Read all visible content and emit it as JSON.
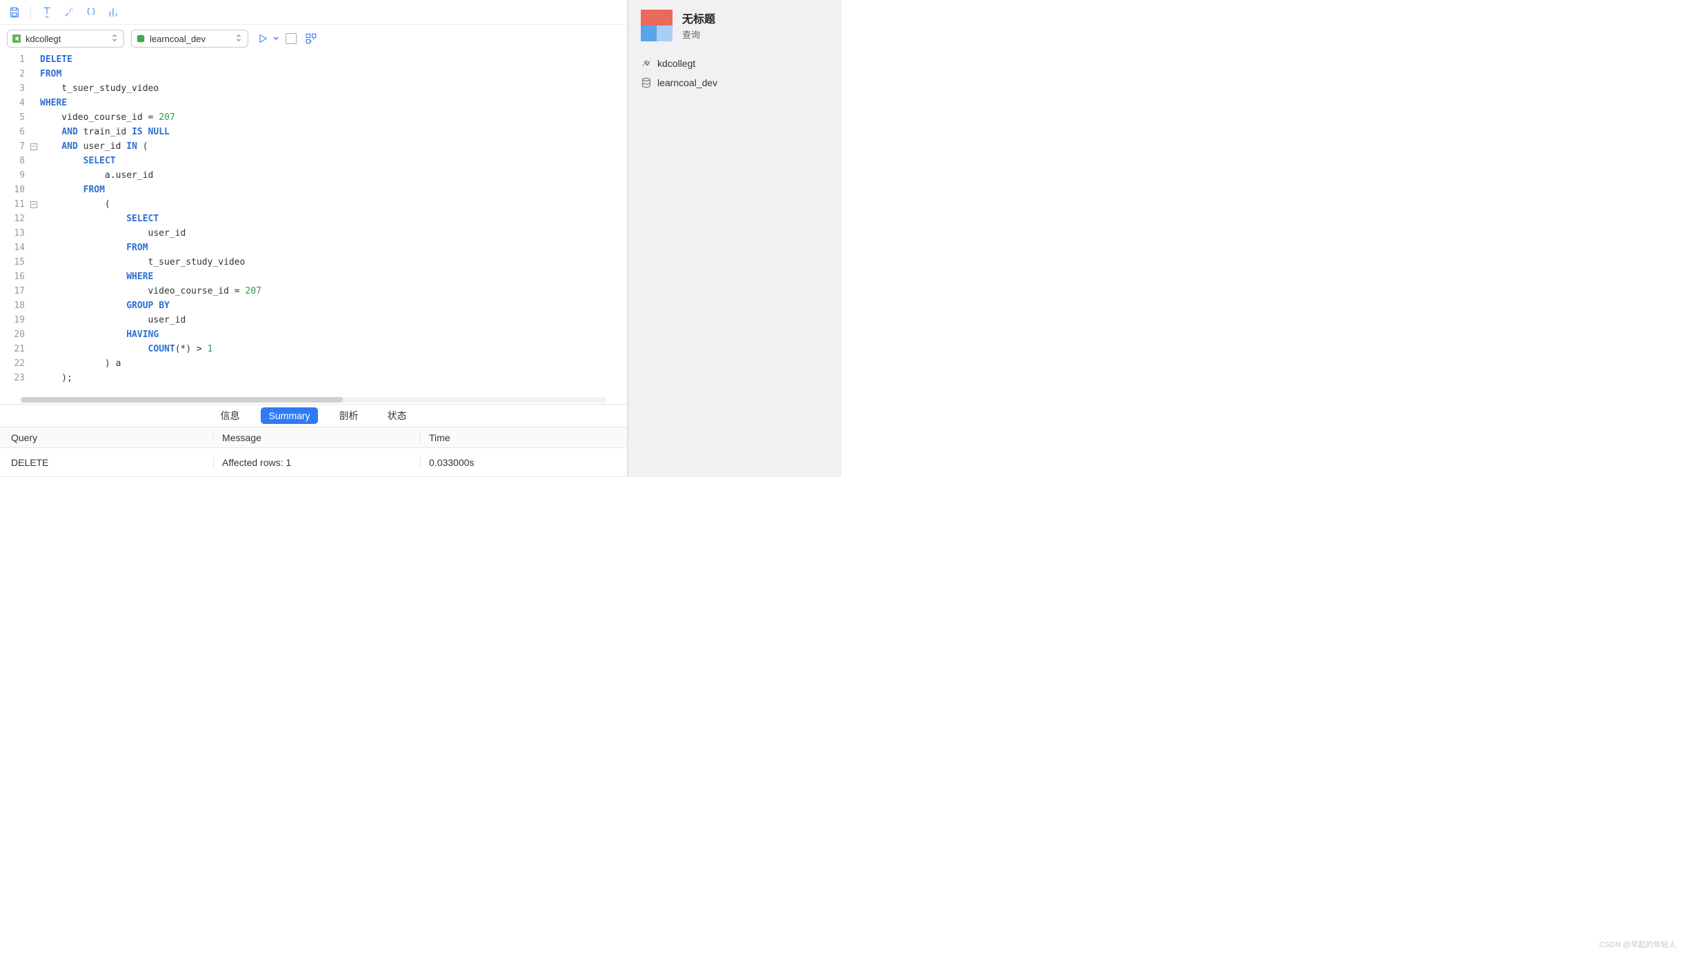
{
  "toolbar": {
    "connection_selector": "kdcollegt",
    "database_selector": "learncoal_dev"
  },
  "editor": {
    "lines": [
      {
        "n": 1,
        "fold": "",
        "tokens": [
          [
            "kw",
            "DELETE"
          ]
        ]
      },
      {
        "n": 2,
        "fold": "",
        "tokens": [
          [
            "kw",
            "FROM"
          ]
        ]
      },
      {
        "n": 3,
        "fold": "",
        "tokens": [
          [
            "ident",
            "    t_suer_study_video"
          ]
        ]
      },
      {
        "n": 4,
        "fold": "",
        "tokens": [
          [
            "kw",
            "WHERE"
          ]
        ]
      },
      {
        "n": 5,
        "fold": "",
        "tokens": [
          [
            "ident",
            "    video_course_id = "
          ],
          [
            "num",
            "207"
          ]
        ]
      },
      {
        "n": 6,
        "fold": "",
        "tokens": [
          [
            "ident",
            "    "
          ],
          [
            "kw",
            "AND"
          ],
          [
            "ident",
            " train_id "
          ],
          [
            "kw",
            "IS NULL"
          ]
        ]
      },
      {
        "n": 7,
        "fold": "-",
        "tokens": [
          [
            "ident",
            "    "
          ],
          [
            "kw",
            "AND"
          ],
          [
            "ident",
            " user_id "
          ],
          [
            "kw",
            "IN"
          ],
          [
            "ident",
            " ("
          ]
        ]
      },
      {
        "n": 8,
        "fold": "",
        "tokens": [
          [
            "ident",
            "        "
          ],
          [
            "kw",
            "SELECT"
          ]
        ]
      },
      {
        "n": 9,
        "fold": "",
        "tokens": [
          [
            "ident",
            "            a.user_id"
          ]
        ]
      },
      {
        "n": 10,
        "fold": "",
        "tokens": [
          [
            "ident",
            "        "
          ],
          [
            "kw",
            "FROM"
          ]
        ]
      },
      {
        "n": 11,
        "fold": "-",
        "tokens": [
          [
            "ident",
            "            ("
          ]
        ]
      },
      {
        "n": 12,
        "fold": "",
        "tokens": [
          [
            "ident",
            "                "
          ],
          [
            "kw",
            "SELECT"
          ]
        ]
      },
      {
        "n": 13,
        "fold": "",
        "tokens": [
          [
            "ident",
            "                    user_id"
          ]
        ]
      },
      {
        "n": 14,
        "fold": "",
        "tokens": [
          [
            "ident",
            "                "
          ],
          [
            "kw",
            "FROM"
          ]
        ]
      },
      {
        "n": 15,
        "fold": "",
        "tokens": [
          [
            "ident",
            "                    t_suer_study_video"
          ]
        ]
      },
      {
        "n": 16,
        "fold": "",
        "tokens": [
          [
            "ident",
            "                "
          ],
          [
            "kw",
            "WHERE"
          ]
        ]
      },
      {
        "n": 17,
        "fold": "",
        "tokens": [
          [
            "ident",
            "                    video_course_id = "
          ],
          [
            "num",
            "207"
          ]
        ]
      },
      {
        "n": 18,
        "fold": "",
        "tokens": [
          [
            "ident",
            "                "
          ],
          [
            "kw",
            "GROUP BY"
          ]
        ]
      },
      {
        "n": 19,
        "fold": "",
        "tokens": [
          [
            "ident",
            "                    user_id"
          ]
        ]
      },
      {
        "n": 20,
        "fold": "",
        "tokens": [
          [
            "ident",
            "                "
          ],
          [
            "kw",
            "HAVING"
          ]
        ]
      },
      {
        "n": 21,
        "fold": "",
        "tokens": [
          [
            "ident",
            "                    "
          ],
          [
            "kw2",
            "COUNT"
          ],
          [
            "ident",
            "(*) > "
          ],
          [
            "num",
            "1"
          ]
        ]
      },
      {
        "n": 22,
        "fold": "",
        "tokens": [
          [
            "ident",
            "            ) a"
          ]
        ]
      },
      {
        "n": 23,
        "fold": "",
        "tokens": [
          [
            "ident",
            "    );"
          ]
        ]
      }
    ]
  },
  "results": {
    "tabs": {
      "info": "信息",
      "summary": "Summary",
      "profile": "剖析",
      "status": "状态"
    },
    "headers": {
      "query": "Query",
      "message": "Message",
      "time": "Time"
    },
    "row": {
      "query": "DELETE",
      "message": "Affected rows: 1",
      "time": "0.033000s"
    }
  },
  "sidebar": {
    "title": "无标题",
    "subtitle": "查询",
    "conn": "kdcollegt",
    "db": "learncoal_dev"
  },
  "watermark": "CSDN @早起的年轻人"
}
